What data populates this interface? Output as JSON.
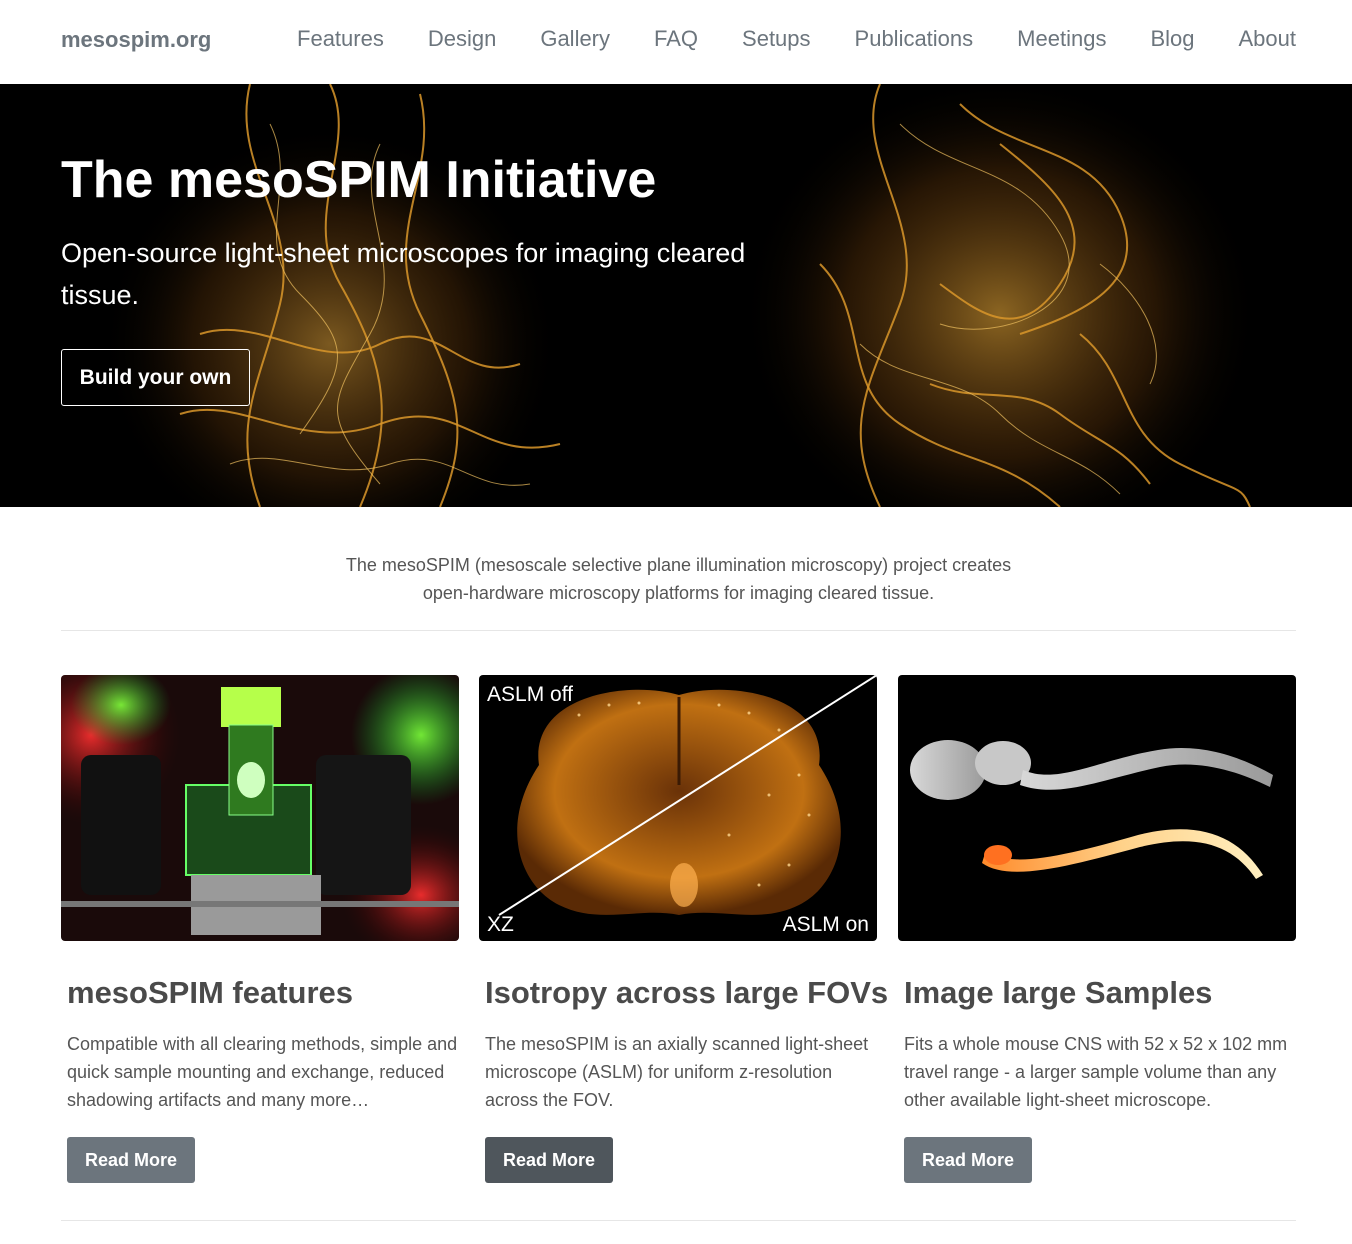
{
  "navbar": {
    "brand": "mesospim.org",
    "items": [
      "Features",
      "Design",
      "Gallery",
      "FAQ",
      "Setups",
      "Publications",
      "Meetings",
      "Blog",
      "About"
    ]
  },
  "hero": {
    "title": "The mesoSPIM Initiative",
    "subtitle": "Open-source light-sheet microscopes for imaging cleared tissue.",
    "button_label": "Build your own"
  },
  "intro": {
    "line1": "The mesoSPIM (mesoscale selective plane illumination microscopy) project creates",
    "line2": "open-hardware microscopy platforms for imaging cleared tissue."
  },
  "cards": [
    {
      "title": "mesoSPIM features",
      "text": "Compatible with all clearing methods, simple and quick sample mounting and exchange, reduced shadowing artifacts and many more…",
      "button": "Read More"
    },
    {
      "title": "Isotropy across large FOVs",
      "text": "The mesoSPIM is an axially scanned light-sheet microscope (ASLM) for uniform z-resolution across the FOV.",
      "button": "Read More",
      "image_labels": {
        "top_left": "ASLM off",
        "bottom_left": "XZ",
        "bottom_right": "ASLM on"
      }
    },
    {
      "title": "Image large Samples",
      "text": "Fits a whole mouse CNS with 52 x 52 x 102 mm travel range - a larger sample volume than any other available light-sheet microscope.",
      "button": "Read More"
    }
  ],
  "colors": {
    "nav_text": "#6c757d",
    "button_gray": "#6c757d",
    "button_dark": "#4f565c",
    "hero_accent": "#d9962a"
  }
}
